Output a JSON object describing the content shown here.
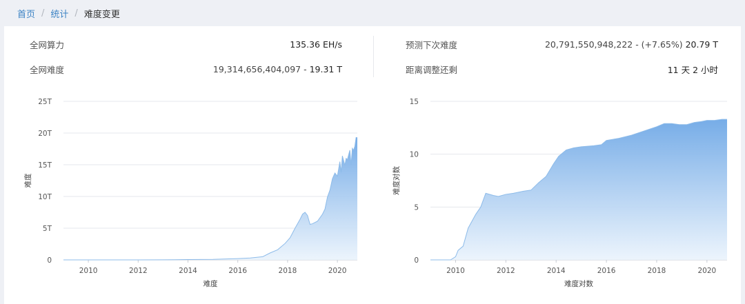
{
  "breadcrumb": {
    "home": "首页",
    "stats": "统计",
    "current": "难度变更",
    "separator": "/"
  },
  "stats": {
    "hashrate_label": "全网算力",
    "hashrate_value": "135.36 EH/s",
    "difficulty_label": "全网难度",
    "difficulty_raw": "19,314,656,404,097",
    "difficulty_dash": " - ",
    "difficulty_short": "19.31 T",
    "next_label": "预测下次难度",
    "next_raw": "20,791,550,948,222",
    "next_change": " - (+7.65%) ",
    "next_short": "20.79 T",
    "adjust_label": "距离调整还剩",
    "adjust_value": "11 天 2 小时"
  },
  "colors": {
    "link": "#3b82c4",
    "area_top": "#6fa8e6",
    "area_bottom": "#eaf3fc",
    "line": "#8dbbe9"
  },
  "chart_data": [
    {
      "type": "area",
      "ylabel": "难度",
      "xlabel": "难度",
      "x_ticks": [
        "2010",
        "2012",
        "2014",
        "2016",
        "2018",
        "2020"
      ],
      "y_ticks": [
        "0",
        "5T",
        "10T",
        "15T",
        "20T",
        "25T"
      ],
      "ylim": [
        0,
        25
      ],
      "xlim": [
        2009.0,
        2020.8
      ],
      "grid": true,
      "x": [
        2009.0,
        2010.0,
        2011.0,
        2012.0,
        2013.0,
        2014.0,
        2015.0,
        2016.0,
        2016.5,
        2017.0,
        2017.3,
        2017.6,
        2017.9,
        2018.1,
        2018.3,
        2018.5,
        2018.6,
        2018.7,
        2018.8,
        2018.9,
        2019.0,
        2019.2,
        2019.4,
        2019.5,
        2019.6,
        2019.7,
        2019.8,
        2019.9,
        2020.0,
        2020.1,
        2020.15,
        2020.2,
        2020.3,
        2020.35,
        2020.4,
        2020.5,
        2020.55,
        2020.6,
        2020.65,
        2020.7,
        2020.75,
        2020.8
      ],
      "y": [
        0,
        0,
        0,
        0,
        0.01,
        0.05,
        0.08,
        0.2,
        0.3,
        0.5,
        1.1,
        1.6,
        2.6,
        3.5,
        5.0,
        6.4,
        7.2,
        7.5,
        7.0,
        5.6,
        5.7,
        6.1,
        7.2,
        8.0,
        9.9,
        11.0,
        12.8,
        13.7,
        13.2,
        15.5,
        13.8,
        16.4,
        14.9,
        16.0,
        15.8,
        17.3,
        15.0,
        17.6,
        17.3,
        17.9,
        19.3,
        19.3
      ]
    },
    {
      "type": "area",
      "ylabel": "难度对数",
      "xlabel": "难度对数",
      "x_ticks": [
        "2010",
        "2012",
        "2014",
        "2016",
        "2018",
        "2020"
      ],
      "y_ticks": [
        "0",
        "5",
        "10",
        "15"
      ],
      "ylim": [
        0,
        15
      ],
      "xlim": [
        2009.0,
        2020.8
      ],
      "grid": true,
      "x": [
        2009.0,
        2009.8,
        2010.0,
        2010.1,
        2010.3,
        2010.5,
        2010.8,
        2011.0,
        2011.2,
        2011.5,
        2011.7,
        2012.0,
        2012.3,
        2012.7,
        2013.0,
        2013.3,
        2013.6,
        2013.9,
        2014.1,
        2014.4,
        2014.7,
        2015.0,
        2015.5,
        2015.8,
        2016.0,
        2016.5,
        2017.0,
        2017.5,
        2018.0,
        2018.3,
        2018.6,
        2018.9,
        2019.2,
        2019.5,
        2019.8,
        2020.0,
        2020.3,
        2020.6,
        2020.8
      ],
      "y": [
        0,
        0,
        0.3,
        0.9,
        1.3,
        3.0,
        4.3,
        5.0,
        6.3,
        6.1,
        6.0,
        6.2,
        6.3,
        6.5,
        6.6,
        7.3,
        7.9,
        9.1,
        9.8,
        10.4,
        10.6,
        10.7,
        10.8,
        10.9,
        11.3,
        11.5,
        11.8,
        12.2,
        12.6,
        12.9,
        12.9,
        12.8,
        12.8,
        13.0,
        13.1,
        13.2,
        13.2,
        13.3,
        13.3
      ]
    }
  ]
}
